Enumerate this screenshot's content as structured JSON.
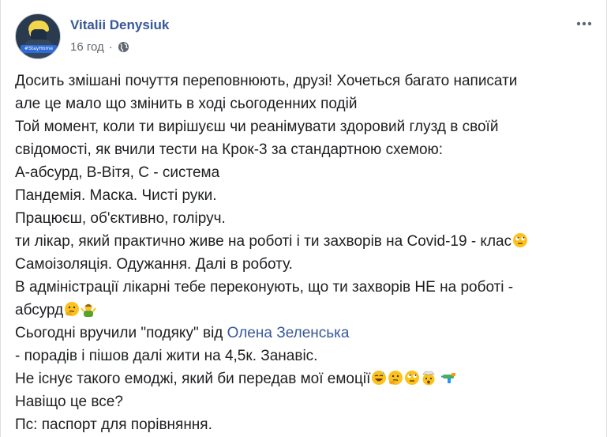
{
  "post": {
    "author": "Vitalii Denysiuk",
    "avatar_badge": "#StayHome",
    "time": "16 год",
    "separator": "·",
    "privacy_icon": "globe-icon",
    "more_icon": "more-horizontal-icon",
    "lines": [
      "Досить змішані почуття переповнюють, друзі! Хочеться багато написати",
      "але це мало що змінить в ході сьогоденних подій",
      "Той момент, коли ти вирішуєш чи реанімувати здоровий глузд в своїй",
      "свідомості, як вчили тести на Крок-3 за стандартною схемою:",
      "А-абсурд, В-Вітя, С - система",
      "Пандемія. Маска. Чисті руки.",
      "Працюєш, об'єктивно, голіруч.",
      "ти лікар, який практично живе на роботі і ти захворів на Covid-19 - клас",
      "Самоізоляція. Одужання. Далі в роботу.",
      "В адміністрації лікарні тебе переконують, що ти захворів НЕ на роботі -",
      "абсурд"
    ],
    "line_thanks_prefix": "Сьогодні вручили \"подяку\" від ",
    "mention": "Олена Зеленська",
    "tail_lines": [
      "- порадів і пішов далі жити на 4,5к. Занавіс.",
      "Не існує такого емоджі, який би передав мої емоції",
      "Навіщо це все?",
      "Пс: паспорт для порівняння."
    ],
    "emoji": {
      "class": "face-with-rolling-eyes-emoji",
      "absurd": [
        "thinking-face-emoji",
        "man-shrugging-emoji"
      ],
      "emotions": [
        "grinning-sweat-emoji",
        "thinking-face-emoji",
        "face-with-rolling-eyes-emoji",
        "exploding-head-emoji",
        "water-pistol-emoji"
      ]
    }
  }
}
